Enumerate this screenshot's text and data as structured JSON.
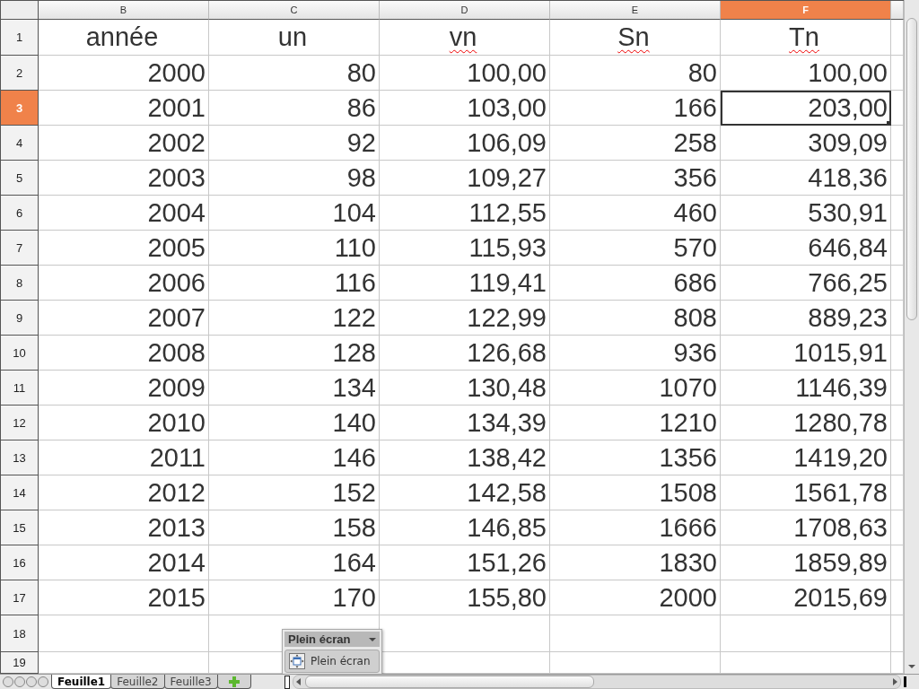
{
  "columns": [
    {
      "label": "B",
      "selected": false
    },
    {
      "label": "C",
      "selected": false
    },
    {
      "label": "D",
      "selected": false
    },
    {
      "label": "E",
      "selected": false
    },
    {
      "label": "F",
      "selected": true
    }
  ],
  "title_row": {
    "number": "1",
    "selected": false,
    "cells": [
      {
        "value": "année",
        "misspelled": false
      },
      {
        "value": "un",
        "misspelled": false
      },
      {
        "value": "vn",
        "misspelled": true
      },
      {
        "value": "Sn",
        "misspelled": true
      },
      {
        "value": "Tn",
        "misspelled": true
      }
    ]
  },
  "rows": [
    {
      "number": "2",
      "selected": false,
      "cells": [
        {
          "value": "2000",
          "selected": false
        },
        {
          "value": "80",
          "selected": false
        },
        {
          "value": "100,00",
          "selected": false
        },
        {
          "value": "80",
          "selected": false
        },
        {
          "value": "100,00",
          "selected": false
        }
      ]
    },
    {
      "number": "3",
      "selected": true,
      "cells": [
        {
          "value": "2001",
          "selected": false
        },
        {
          "value": "86",
          "selected": false
        },
        {
          "value": "103,00",
          "selected": false
        },
        {
          "value": "166",
          "selected": false
        },
        {
          "value": "203,00",
          "selected": true
        }
      ]
    },
    {
      "number": "4",
      "selected": false,
      "cells": [
        {
          "value": "2002",
          "selected": false
        },
        {
          "value": "92",
          "selected": false
        },
        {
          "value": "106,09",
          "selected": false
        },
        {
          "value": "258",
          "selected": false
        },
        {
          "value": "309,09",
          "selected": false
        }
      ]
    },
    {
      "number": "5",
      "selected": false,
      "cells": [
        {
          "value": "2003",
          "selected": false
        },
        {
          "value": "98",
          "selected": false
        },
        {
          "value": "109,27",
          "selected": false
        },
        {
          "value": "356",
          "selected": false
        },
        {
          "value": "418,36",
          "selected": false
        }
      ]
    },
    {
      "number": "6",
      "selected": false,
      "cells": [
        {
          "value": "2004",
          "selected": false
        },
        {
          "value": "104",
          "selected": false
        },
        {
          "value": "112,55",
          "selected": false
        },
        {
          "value": "460",
          "selected": false
        },
        {
          "value": "530,91",
          "selected": false
        }
      ]
    },
    {
      "number": "7",
      "selected": false,
      "cells": [
        {
          "value": "2005",
          "selected": false
        },
        {
          "value": "110",
          "selected": false
        },
        {
          "value": "115,93",
          "selected": false
        },
        {
          "value": "570",
          "selected": false
        },
        {
          "value": "646,84",
          "selected": false
        }
      ]
    },
    {
      "number": "8",
      "selected": false,
      "cells": [
        {
          "value": "2006",
          "selected": false
        },
        {
          "value": "116",
          "selected": false
        },
        {
          "value": "119,41",
          "selected": false
        },
        {
          "value": "686",
          "selected": false
        },
        {
          "value": "766,25",
          "selected": false
        }
      ]
    },
    {
      "number": "9",
      "selected": false,
      "cells": [
        {
          "value": "2007",
          "selected": false
        },
        {
          "value": "122",
          "selected": false
        },
        {
          "value": "122,99",
          "selected": false
        },
        {
          "value": "808",
          "selected": false
        },
        {
          "value": "889,23",
          "selected": false
        }
      ]
    },
    {
      "number": "10",
      "selected": false,
      "cells": [
        {
          "value": "2008",
          "selected": false
        },
        {
          "value": "128",
          "selected": false
        },
        {
          "value": "126,68",
          "selected": false
        },
        {
          "value": "936",
          "selected": false
        },
        {
          "value": "1015,91",
          "selected": false
        }
      ]
    },
    {
      "number": "11",
      "selected": false,
      "cells": [
        {
          "value": "2009",
          "selected": false
        },
        {
          "value": "134",
          "selected": false
        },
        {
          "value": "130,48",
          "selected": false
        },
        {
          "value": "1070",
          "selected": false
        },
        {
          "value": "1146,39",
          "selected": false
        }
      ]
    },
    {
      "number": "12",
      "selected": false,
      "cells": [
        {
          "value": "2010",
          "selected": false
        },
        {
          "value": "140",
          "selected": false
        },
        {
          "value": "134,39",
          "selected": false
        },
        {
          "value": "1210",
          "selected": false
        },
        {
          "value": "1280,78",
          "selected": false
        }
      ]
    },
    {
      "number": "13",
      "selected": false,
      "cells": [
        {
          "value": "2011",
          "selected": false
        },
        {
          "value": "146",
          "selected": false
        },
        {
          "value": "138,42",
          "selected": false
        },
        {
          "value": "1356",
          "selected": false
        },
        {
          "value": "1419,20",
          "selected": false
        }
      ]
    },
    {
      "number": "14",
      "selected": false,
      "cells": [
        {
          "value": "2012",
          "selected": false
        },
        {
          "value": "152",
          "selected": false
        },
        {
          "value": "142,58",
          "selected": false
        },
        {
          "value": "1508",
          "selected": false
        },
        {
          "value": "1561,78",
          "selected": false
        }
      ]
    },
    {
      "number": "15",
      "selected": false,
      "cells": [
        {
          "value": "2013",
          "selected": false
        },
        {
          "value": "158",
          "selected": false
        },
        {
          "value": "146,85",
          "selected": false
        },
        {
          "value": "1666",
          "selected": false
        },
        {
          "value": "1708,63",
          "selected": false
        }
      ]
    },
    {
      "number": "16",
      "selected": false,
      "cells": [
        {
          "value": "2014",
          "selected": false
        },
        {
          "value": "164",
          "selected": false
        },
        {
          "value": "151,26",
          "selected": false
        },
        {
          "value": "1830",
          "selected": false
        },
        {
          "value": "1859,89",
          "selected": false
        }
      ]
    },
    {
      "number": "17",
      "selected": false,
      "cells": [
        {
          "value": "2015",
          "selected": false
        },
        {
          "value": "170",
          "selected": false
        },
        {
          "value": "155,80",
          "selected": false
        },
        {
          "value": "2000",
          "selected": false
        },
        {
          "value": "2015,69",
          "selected": false
        }
      ]
    },
    {
      "number": "18",
      "selected": false,
      "cells": []
    },
    {
      "number": "19",
      "selected": false,
      "cells": []
    }
  ],
  "sheet_tabs": [
    {
      "label": "Feuille1",
      "selected": true
    },
    {
      "label": "Feuille2",
      "selected": false
    },
    {
      "label": "Feuille3",
      "selected": false
    }
  ],
  "floating_toolbar": {
    "title": "Plein écran",
    "button": "Plein écran"
  }
}
